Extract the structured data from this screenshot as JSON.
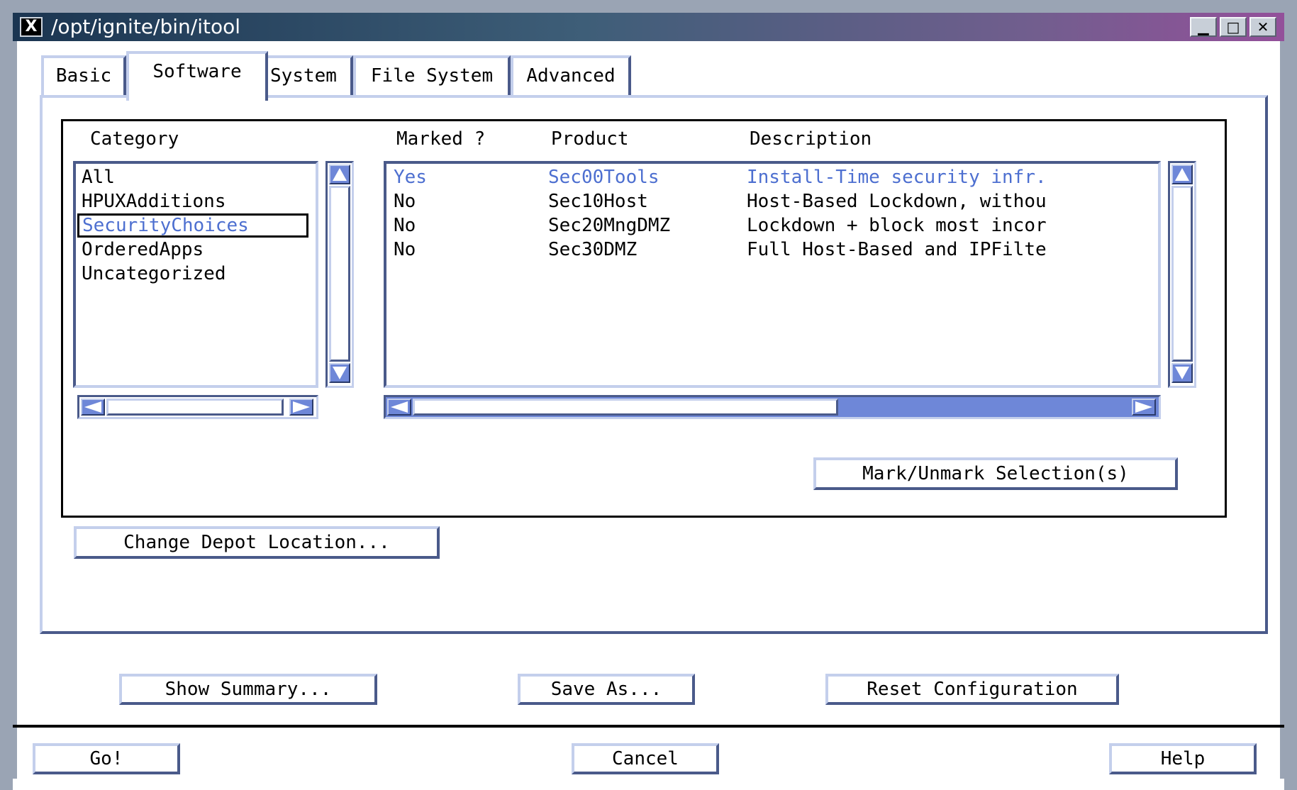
{
  "window": {
    "title": "/opt/ignite/bin/itool",
    "x_icon": "X",
    "buttons": {
      "minimize": "▁",
      "maximize": "□",
      "close": "✕"
    }
  },
  "tabs": [
    {
      "label": "Basic"
    },
    {
      "label": "Software"
    },
    {
      "label": "System"
    },
    {
      "label": "File System"
    },
    {
      "label": "Advanced"
    }
  ],
  "active_tab": "Software",
  "software": {
    "category_header": "Category",
    "marked_header": "Marked ?",
    "product_header": "Product",
    "description_header": "Description",
    "categories": [
      {
        "label": "All"
      },
      {
        "label": "HPUXAdditions"
      },
      {
        "label": "SecurityChoices"
      },
      {
        "label": "OrderedApps"
      },
      {
        "label": "Uncategorized"
      }
    ],
    "selected_category": "SecurityChoices",
    "rows": [
      {
        "marked": "Yes",
        "product": "Sec00Tools",
        "description": "Install-Time security infr."
      },
      {
        "marked": "No",
        "product": "Sec10Host",
        "description": "Host-Based Lockdown, withou"
      },
      {
        "marked": "No",
        "product": "Sec20MngDMZ",
        "description": "Lockdown + block most incor"
      },
      {
        "marked": "No",
        "product": "Sec30DMZ",
        "description": "Full Host-Based and IPFilte"
      }
    ],
    "mark_button": "Mark/Unmark Selection(s)",
    "change_depot_button": "Change Depot Location..."
  },
  "actions": {
    "show_summary": "Show Summary...",
    "save_as": "Save As...",
    "reset": "Reset Configuration",
    "go": "Go!",
    "cancel": "Cancel",
    "help": "Help"
  },
  "icons": {
    "up": "▲",
    "down": "▼",
    "left": "◀",
    "right": "▶"
  },
  "colors": {
    "selection": "#4d6fd0",
    "scroll_trough": "#6e87d8",
    "bevel_light": "#c4cfec",
    "bevel_dark": "#4a5a8a"
  }
}
